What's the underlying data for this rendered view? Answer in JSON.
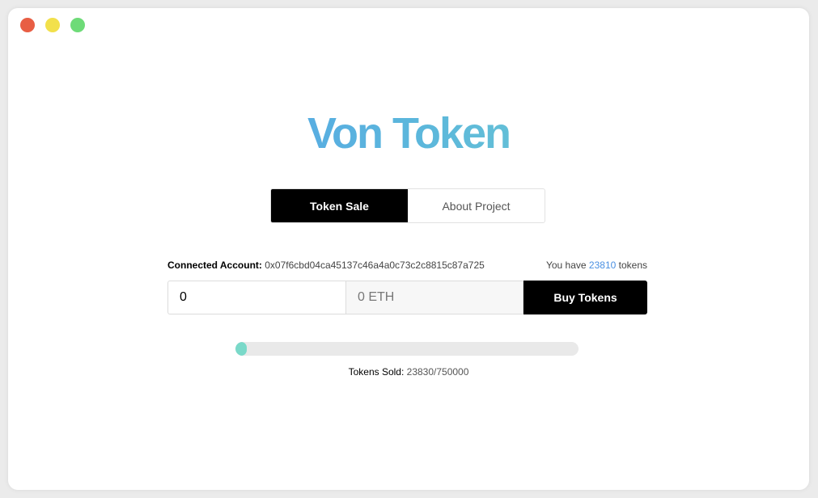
{
  "app": {
    "title": "Von Token"
  },
  "tabs": [
    {
      "label": "Token Sale",
      "active": true
    },
    {
      "label": "About Project",
      "active": false
    }
  ],
  "account": {
    "label": "Connected Account:",
    "address": "0x07f6cbd04ca45137c46a4a0c73c2c8815c87a725"
  },
  "balance": {
    "prefix": "You have",
    "amount": "23810",
    "suffix": "tokens"
  },
  "buy": {
    "amount_value": "0",
    "eth_value": "0 ETH",
    "button_label": "Buy Tokens"
  },
  "sale": {
    "label": "Tokens Sold:",
    "value": "23830/750000",
    "sold": 23830,
    "total": 750000
  },
  "colors": {
    "accent_blue": "#4a90e2",
    "progress": "#7ad9c9",
    "title_gradient_start": "#4e95f1",
    "title_gradient_end": "#7ad9c9"
  }
}
